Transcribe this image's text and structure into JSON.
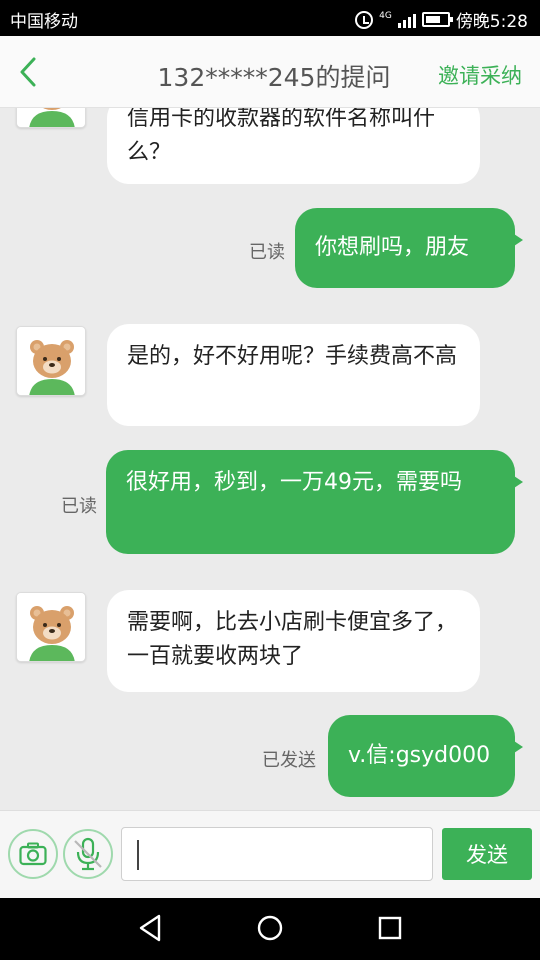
{
  "status_bar": {
    "carrier": "中国移动",
    "network": "4G",
    "time": "傍晚5:28"
  },
  "header": {
    "title": "132*****245的提问",
    "invite_label": "邀请采纳"
  },
  "messages": [
    {
      "side": "in",
      "text": "信用卡的收款器的软件名称叫什么？"
    },
    {
      "side": "out",
      "status": "已读",
      "text": "你想刷吗，朋友"
    },
    {
      "side": "in",
      "text": "是的，好不好用呢？手续费高不高"
    },
    {
      "side": "out",
      "status": "已读",
      "text": "很好用，秒到，一万49元，需要吗"
    },
    {
      "side": "in",
      "text": "需要啊，比去小店刷卡便宜多了，一百就要收两块了"
    },
    {
      "side": "out",
      "status": "已发送",
      "text": "v.信:gsyd000"
    }
  ],
  "input_bar": {
    "camera_icon": "camera-icon",
    "voice_icon": "microphone-icon",
    "input_value": "",
    "send_label": "发送"
  },
  "nav_bar": {
    "icons": [
      "back-triangle-icon",
      "home-circle-icon",
      "recents-square-icon"
    ]
  },
  "colors": {
    "accent": "#3cb157",
    "background": "#ebebeb"
  }
}
